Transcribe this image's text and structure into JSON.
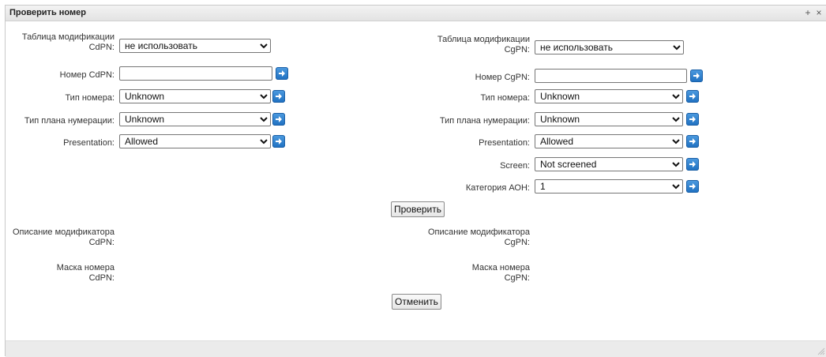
{
  "window": {
    "title": "Проверить номер",
    "plus": "+",
    "close": "×"
  },
  "left": {
    "mod_table_label_1": "Таблица модификации",
    "mod_table_label_2": "CdPN:",
    "mod_table_value": "не использовать",
    "number_label": "Номер CdPN:",
    "number_value": "",
    "type_label": "Тип номера:",
    "type_value": "Unknown",
    "plan_label": "Тип плана нумерации:",
    "plan_value": "Unknown",
    "presentation_label": "Presentation:",
    "presentation_value": "Allowed",
    "desc_label_1": "Описание модификатора",
    "desc_label_2": "CdPN:",
    "mask_label_1": "Маска номера",
    "mask_label_2": "CdPN:"
  },
  "right": {
    "mod_table_label_1": "Таблица модификации",
    "mod_table_label_2": "CgPN:",
    "mod_table_value": "не использовать",
    "number_label": "Номер CgPN:",
    "number_value": "",
    "type_label": "Тип номера:",
    "type_value": "Unknown",
    "plan_label": "Тип плана нумерации:",
    "plan_value": "Unknown",
    "presentation_label": "Presentation:",
    "presentation_value": "Allowed",
    "screen_label": "Screen:",
    "screen_value": "Not screened",
    "aon_label": "Категория АОН:",
    "aon_value": "1",
    "desc_label_1": "Описание модификатора",
    "desc_label_2": "CgPN:",
    "mask_label_1": "Маска номера",
    "mask_label_2": "CgPN:"
  },
  "buttons": {
    "check": "Проверить",
    "cancel": "Отменить"
  },
  "icons": {
    "apply": "arrow-right-icon",
    "close": "close-icon",
    "add": "plus-icon"
  },
  "colors": {
    "apply_button": "#2a7fd0"
  }
}
